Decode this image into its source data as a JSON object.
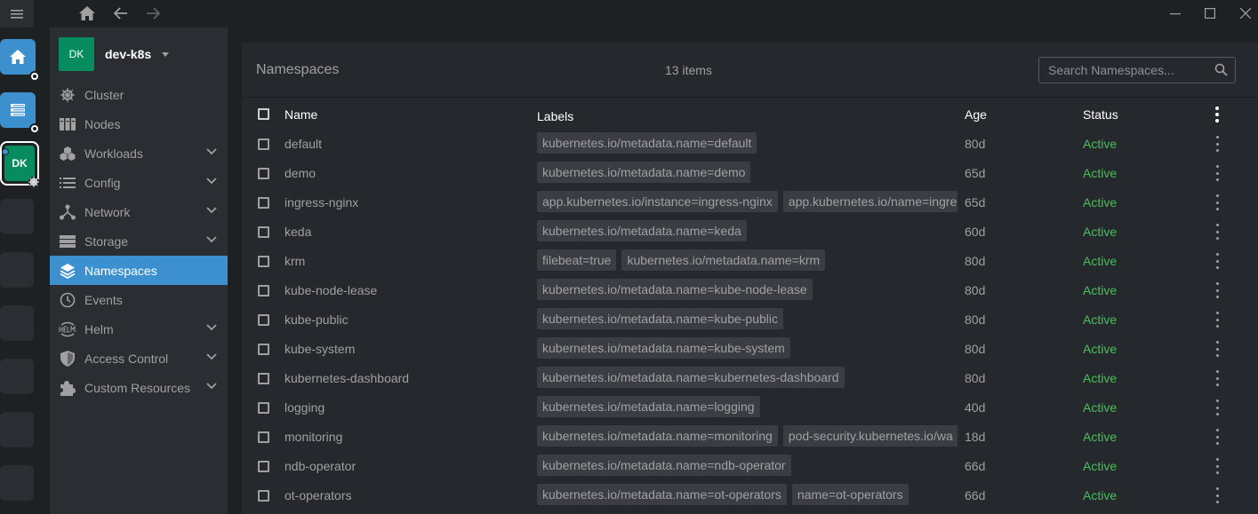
{
  "colors": {
    "accent": "#3d90ce",
    "cluster": "#068c5f",
    "active": "#48c05a"
  },
  "topbar": {
    "icons": [
      "hamburger-icon",
      "home-icon",
      "arrow-left-icon",
      "arrow-right-icon",
      "minimize-icon",
      "maximize-icon",
      "close-icon"
    ]
  },
  "hotbar": {
    "cluster_short": "DK"
  },
  "cluster": {
    "avatar": "DK",
    "name": "dev-k8s"
  },
  "sidebar": {
    "items": [
      {
        "label": "Cluster",
        "icon": "helm-wheel-icon",
        "expandable": false
      },
      {
        "label": "Nodes",
        "icon": "nodes-icon",
        "expandable": false
      },
      {
        "label": "Workloads",
        "icon": "workloads-icon",
        "expandable": true
      },
      {
        "label": "Config",
        "icon": "list-icon",
        "expandable": true
      },
      {
        "label": "Network",
        "icon": "network-icon",
        "expandable": true
      },
      {
        "label": "Storage",
        "icon": "storage-icon",
        "expandable": true
      },
      {
        "label": "Namespaces",
        "icon": "layers-icon",
        "expandable": false,
        "active": true
      },
      {
        "label": "Events",
        "icon": "clock-icon",
        "expandable": false
      },
      {
        "label": "Helm",
        "icon": "helm-icon",
        "expandable": true
      },
      {
        "label": "Access Control",
        "icon": "shield-icon",
        "expandable": true
      },
      {
        "label": "Custom Resources",
        "icon": "puzzle-icon",
        "expandable": true
      }
    ]
  },
  "main": {
    "title": "Namespaces",
    "count": "13 items",
    "search_placeholder": "Search Namespaces...",
    "columns": {
      "name": "Name",
      "labels": "Labels",
      "age": "Age",
      "status": "Status"
    },
    "rows": [
      {
        "name": "default",
        "labels": [
          "kubernetes.io/metadata.name=default"
        ],
        "age": "80d",
        "status": "Active"
      },
      {
        "name": "demo",
        "labels": [
          "kubernetes.io/metadata.name=demo"
        ],
        "age": "65d",
        "status": "Active"
      },
      {
        "name": "ingress-nginx",
        "labels": [
          "app.kubernetes.io/instance=ingress-nginx",
          "app.kubernetes.io/name=ingre"
        ],
        "age": "65d",
        "status": "Active"
      },
      {
        "name": "keda",
        "labels": [
          "kubernetes.io/metadata.name=keda"
        ],
        "age": "60d",
        "status": "Active"
      },
      {
        "name": "krm",
        "labels": [
          "filebeat=true",
          "kubernetes.io/metadata.name=krm"
        ],
        "age": "80d",
        "status": "Active"
      },
      {
        "name": "kube-node-lease",
        "labels": [
          "kubernetes.io/metadata.name=kube-node-lease"
        ],
        "age": "80d",
        "status": "Active"
      },
      {
        "name": "kube-public",
        "labels": [
          "kubernetes.io/metadata.name=kube-public"
        ],
        "age": "80d",
        "status": "Active"
      },
      {
        "name": "kube-system",
        "labels": [
          "kubernetes.io/metadata.name=kube-system"
        ],
        "age": "80d",
        "status": "Active"
      },
      {
        "name": "kubernetes-dashboard",
        "labels": [
          "kubernetes.io/metadata.name=kubernetes-dashboard"
        ],
        "age": "80d",
        "status": "Active"
      },
      {
        "name": "logging",
        "labels": [
          "kubernetes.io/metadata.name=logging"
        ],
        "age": "40d",
        "status": "Active"
      },
      {
        "name": "monitoring",
        "labels": [
          "kubernetes.io/metadata.name=monitoring",
          "pod-security.kubernetes.io/wa"
        ],
        "age": "18d",
        "status": "Active"
      },
      {
        "name": "ndb-operator",
        "labels": [
          "kubernetes.io/metadata.name=ndb-operator"
        ],
        "age": "66d",
        "status": "Active"
      },
      {
        "name": "ot-operators",
        "labels": [
          "kubernetes.io/metadata.name=ot-operators",
          "name=ot-operators"
        ],
        "age": "66d",
        "status": "Active"
      }
    ]
  }
}
